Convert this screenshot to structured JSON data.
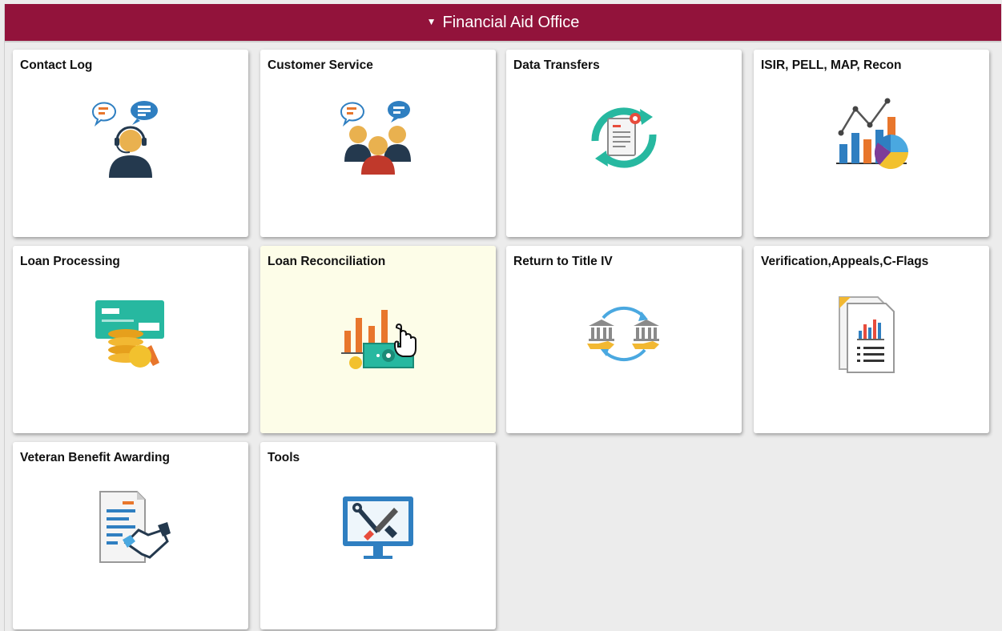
{
  "header": {
    "title": "Financial Aid Office",
    "caret": "▼"
  },
  "colors": {
    "header_bg": "#92133b",
    "hover_tile_bg": "#fdfde8"
  },
  "tiles": [
    {
      "title": "Contact Log",
      "icon": "contact-log-icon"
    },
    {
      "title": "Customer Service",
      "icon": "customer-service-icon"
    },
    {
      "title": "Data Transfers",
      "icon": "data-transfers-icon"
    },
    {
      "title": "ISIR, PELL, MAP, Recon",
      "icon": "isir-pell-map-recon-icon"
    },
    {
      "title": "Loan Processing",
      "icon": "loan-processing-icon"
    },
    {
      "title": "Loan Reconciliation",
      "icon": "loan-reconciliation-icon"
    },
    {
      "title": "Return to Title IV",
      "icon": "return-to-title-iv-icon"
    },
    {
      "title": "Verification,Appeals,C-Flags",
      "icon": "verification-appeals-icon"
    },
    {
      "title": "Veteran Benefit Awarding",
      "icon": "veteran-benefit-icon"
    },
    {
      "title": "Tools",
      "icon": "tools-icon"
    }
  ]
}
